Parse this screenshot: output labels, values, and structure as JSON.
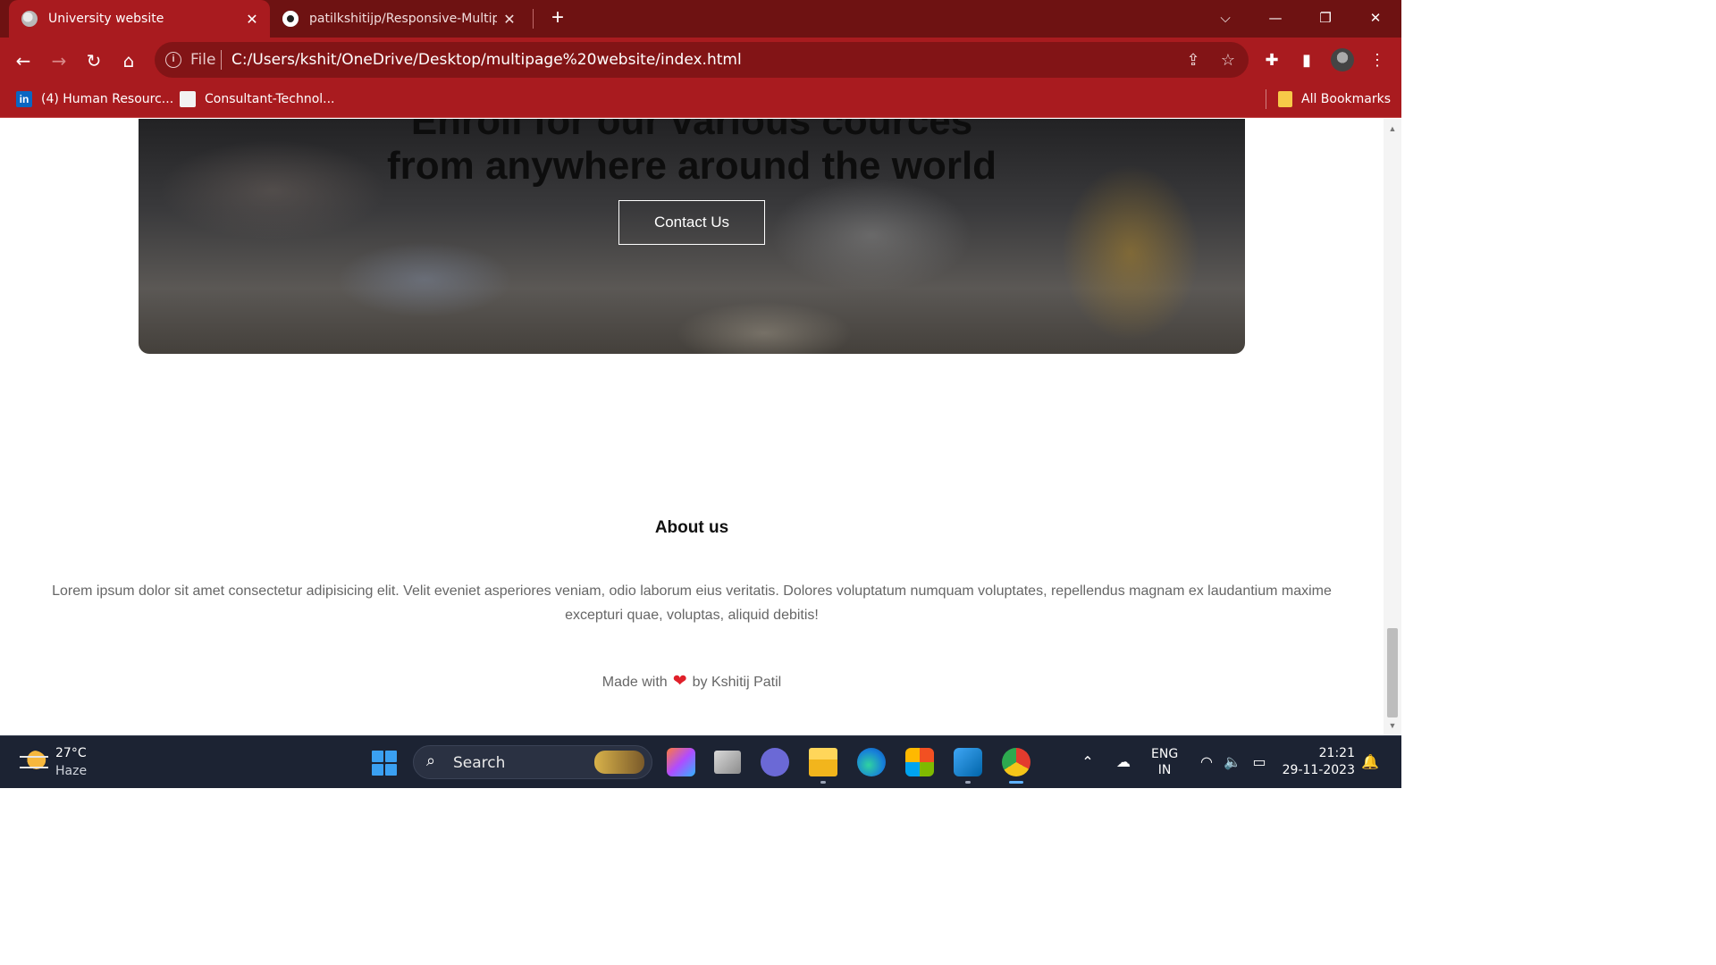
{
  "browser": {
    "tabs": [
      {
        "title": "University website",
        "active": true
      },
      {
        "title": "patilkshitijp/Responsive-Multiple",
        "active": false
      }
    ],
    "address": {
      "scheme_label": "File",
      "url": "C:/Users/kshit/OneDrive/Desktop/multipage%20website/index.html"
    },
    "bookmarks": [
      {
        "label": "(4) Human Resourc...",
        "icon": "linkedin-icon"
      },
      {
        "label": "Consultant-Technol...",
        "icon": "site-icon"
      }
    ],
    "all_bookmarks": "All Bookmarks",
    "linkedin_glyph": "in"
  },
  "page": {
    "hero": {
      "line1": "Enroll for our various cources",
      "line2": "from anywhere around the world",
      "button": "Contact Us"
    },
    "about": {
      "title": "About us",
      "text": "Lorem ipsum dolor sit amet consectetur adipisicing elit. Velit eveniet asperiores veniam, odio laborum eius veritatis. Dolores voluptatum numquam voluptates, repellendus magnam ex laudantium maxime excepturi quae, voluptas, aliquid debitis!"
    },
    "footer": {
      "prefix": "Made with",
      "suffix": "by Kshitij Patil",
      "heart_color": "#e0202a"
    }
  },
  "taskbar": {
    "weather": {
      "temp": "27°C",
      "condition": "Haze"
    },
    "search_label": "Search",
    "language": {
      "line1": "ENG",
      "line2": "IN"
    },
    "clock": {
      "time": "21:21",
      "date": "29-11-2023"
    }
  },
  "colors": {
    "tab_strip": "#6e1212",
    "toolbar": "#a91b1f",
    "taskbar": "#1c2333"
  }
}
